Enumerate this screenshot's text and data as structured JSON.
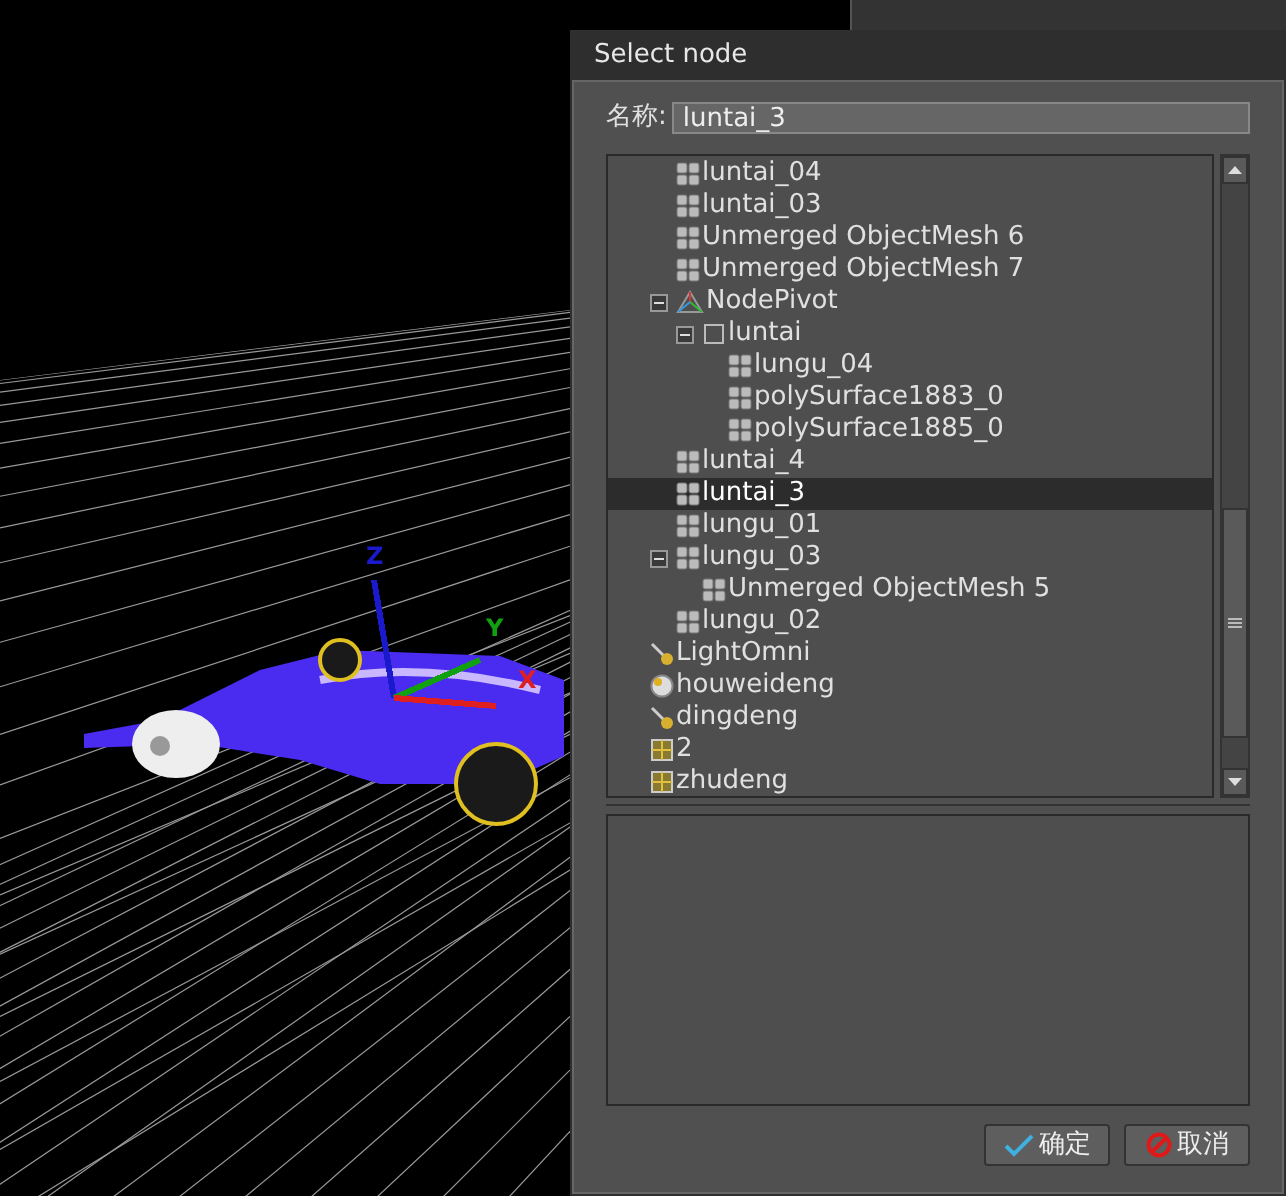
{
  "viewport": {
    "axes": [
      {
        "label": "Z",
        "color": "#1a1acc"
      },
      {
        "label": "Y",
        "color": "#10a010"
      },
      {
        "label": "X",
        "color": "#e02020"
      }
    ]
  },
  "dialog": {
    "title": "Select node",
    "name_label": "名称:",
    "name_value": "luntai_3",
    "tree_branch": [
      {
        "label": "luntai_04",
        "kind": "mesh",
        "selected": false
      },
      {
        "label": "luntai_03",
        "kind": "mesh",
        "selected": false
      },
      {
        "label": "Unmerged ObjectMesh 6",
        "kind": "mesh",
        "selected": false
      },
      {
        "label": "Unmerged ObjectMesh 7",
        "kind": "mesh",
        "selected": false
      },
      {
        "label": "NodePivot",
        "kind": "pivot",
        "expanded": true,
        "selected": false,
        "children": [
          {
            "label": "luntai",
            "kind": "frame",
            "expanded": true,
            "selected": false,
            "children": [
              {
                "label": "lungu_04",
                "kind": "mesh",
                "selected": false
              },
              {
                "label": "polySurface1883_0",
                "kind": "mesh",
                "selected": false
              },
              {
                "label": "polySurface1885_0",
                "kind": "mesh",
                "selected": false
              }
            ]
          }
        ]
      },
      {
        "label": "luntai_4",
        "kind": "mesh",
        "selected": false
      },
      {
        "label": "luntai_3",
        "kind": "mesh",
        "selected": true
      },
      {
        "label": "lungu_01",
        "kind": "mesh",
        "selected": false
      },
      {
        "label": "lungu_03",
        "kind": "mesh",
        "expanded": true,
        "selected": false,
        "children": [
          {
            "label": "Unmerged ObjectMesh 5",
            "kind": "mesh",
            "selected": false
          }
        ]
      },
      {
        "label": "lungu_02",
        "kind": "mesh",
        "selected": false
      }
    ],
    "tree": [
      {
        "label": "LightOmni",
        "kind": "spot",
        "selected": false
      },
      {
        "label": "houweideng",
        "kind": "bulb",
        "selected": false
      },
      {
        "label": "dingdeng",
        "kind": "spot",
        "selected": false
      },
      {
        "label": "2",
        "kind": "box",
        "selected": false
      },
      {
        "label": "zhudeng",
        "kind": "box",
        "selected": false
      }
    ],
    "buttons": [
      {
        "label": "确定",
        "kind": "ok"
      },
      {
        "label": "取消",
        "kind": "cancel"
      }
    ]
  }
}
